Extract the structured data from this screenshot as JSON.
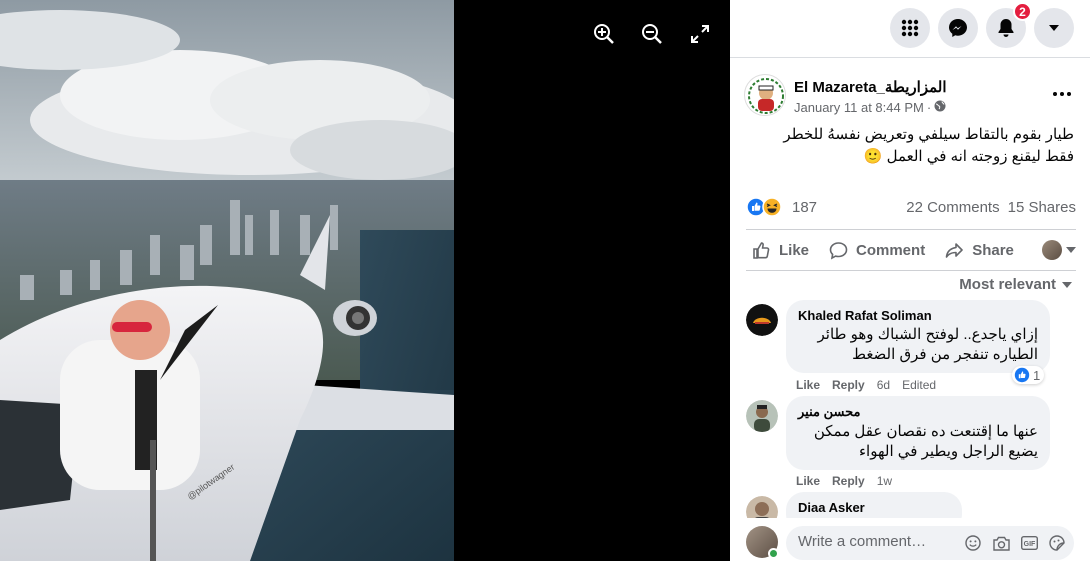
{
  "viewer": {
    "tools": [
      "zoom-in-icon",
      "zoom-out-icon",
      "fullscreen-icon"
    ],
    "photo_watermark": "@pilotwagner"
  },
  "topbar": {
    "menu_icon": "grid-menu-icon",
    "messenger_icon": "messenger-icon",
    "notifications_icon": "bell-icon",
    "notifications_badge": "2",
    "account_icon": "caret-down-icon"
  },
  "post": {
    "page_name": "El Mazareta_المزاريطة",
    "time": "January 11 at 8:44 PM",
    "separator": "·",
    "audience_icon": "globe-icon",
    "text_line1": "طيار بقوم بالتقاط سيلفي وتعريض نفسهُ للخطر",
    "text_line2": "فقط ليقنع زوجته انه في العمل 🙂",
    "reaction_count": "187",
    "comments_count": "22 Comments",
    "shares_count": "15 Shares",
    "like_label": "Like",
    "comment_label": "Comment",
    "share_label": "Share",
    "sort_label": "Most relevant"
  },
  "comments": [
    {
      "author": "Khaled Rafat Soliman",
      "line1": "إزاي ياجدع.. لوفتح الشباك وهو طائر",
      "line2": "الطياره تنفجر من فرق الضغط",
      "like": "Like",
      "reply": "Reply",
      "time": "6d",
      "edited": "Edited",
      "likes": "1"
    },
    {
      "author": "محسن منير",
      "line1": "عنها ما إقتنعت ده نقصان عقل ممكن",
      "line2": "يضيع الراجل ويطير في الهواء",
      "like": "Like",
      "reply": "Reply",
      "time": "1w"
    },
    {
      "author": "Diaa Asker"
    }
  ],
  "composer": {
    "placeholder": "Write a comment…",
    "icons": [
      "emoji-icon",
      "camera-icon",
      "gif-icon",
      "sticker-icon"
    ]
  },
  "colors": {
    "accent": "#1877f2",
    "secondary_text": "#65676b",
    "bubble": "#f0f2f5",
    "badge": "#e41e3f"
  }
}
